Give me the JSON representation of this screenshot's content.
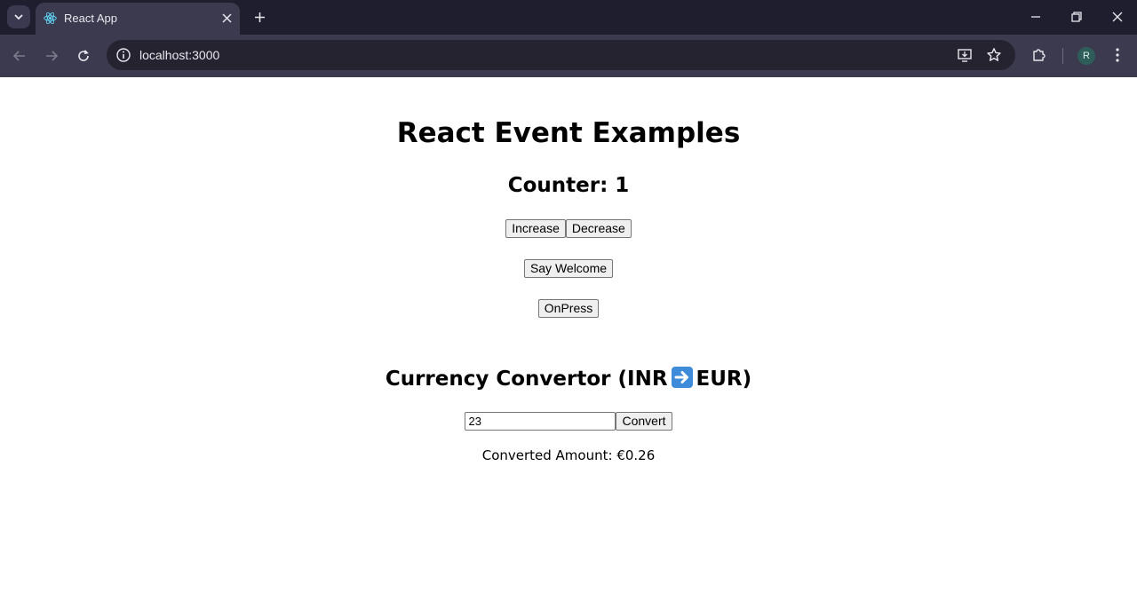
{
  "browser": {
    "tab_title": "React App",
    "url": "localhost:3000",
    "avatar_letter": "R"
  },
  "page": {
    "title": "React Event Examples",
    "counter_label": "Counter: 1",
    "increase_label": "Increase",
    "decrease_label": "Decrease",
    "welcome_label": "Say Welcome",
    "onpress_label": "OnPress",
    "currency_heading_left": "Currency Convertor (INR",
    "currency_heading_right": "EUR)",
    "amount_value": "23",
    "convert_label": "Convert",
    "result_text": "Converted Amount: €0.26"
  },
  "colors": {
    "tabstrip": "#1f1e2e",
    "toolbar": "#3b3a4f",
    "omnibox": "#24232f",
    "emoji_blue": "#3d8bd9"
  }
}
